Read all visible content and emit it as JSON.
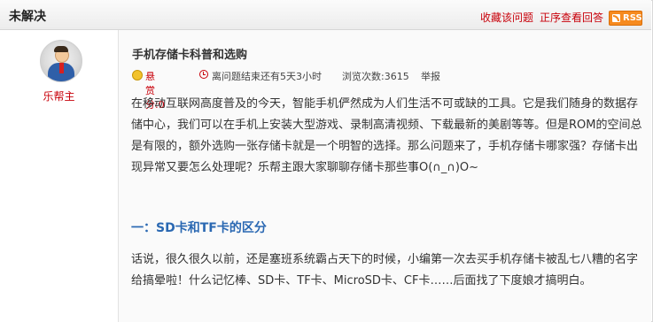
{
  "header": {
    "status": "未解决",
    "favorite_label": "收藏该问题",
    "sort_label": "正序查看回答",
    "rss_label": "RSS"
  },
  "user": {
    "name": "乐帮主"
  },
  "question": {
    "title": "手机存储卡科普和选购",
    "bounty": "悬赏分:0",
    "deadline": "离问题结束还有5天3小时",
    "views": "浏览次数:3615",
    "report": "举报",
    "intro": "在移动互联网高度普及的今天，智能手机俨然成为人们生活不可或缺的工具。它是我们随身的数据存储中心，我们可以在手机上安装大型游戏、录制高清视频、下载最新的美剧等等。但是ROM的空间总是有限的，额外选购一张存储卡就是一个明智的选择。那么问题来了，手机存储卡哪家强？存储卡出现异常又要怎么处理呢？乐帮主跟大家聊聊存储卡那些事O(∩_∩)O~",
    "section_title": "一：SD卡和TF卡的区分",
    "section_text": "话说，很久很久以前，还是塞班系统霸占天下的时候，小编第一次去买手机存储卡被乱七八糟的名字给搞晕啦！什么记忆棒、SD卡、TF卡、MicroSD卡、CF卡……后面找了下度娘才搞明白。"
  },
  "icons": {
    "avatar": "user-avatar-icon",
    "bounty": "coin-icon",
    "deadline": "clock-icon",
    "rss": "rss-icon"
  }
}
